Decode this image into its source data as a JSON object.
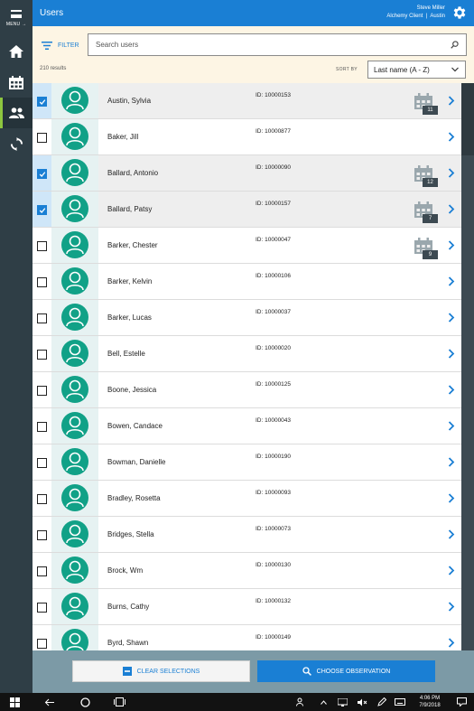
{
  "rail": {
    "menu_label": "MENU",
    "items": [
      "home-icon",
      "calendar-icon",
      "users-icon",
      "sync-icon"
    ],
    "active": "users-icon"
  },
  "header": {
    "title": "Users",
    "user_name": "Steve Miller",
    "org": "Alchemy Client",
    "location": "Austin"
  },
  "filter": {
    "filter_label": "FILTER",
    "search_placeholder": "Search users",
    "results": "210 results",
    "sort_label": "SORT BY",
    "sort_value": "Last name (A - Z)"
  },
  "users": [
    {
      "name": "Austin, Sylvia",
      "id": "ID: 10000153",
      "selected": true,
      "count": "11"
    },
    {
      "name": "Baker, Jill",
      "id": "ID: 10000877",
      "selected": false,
      "count": null
    },
    {
      "name": "Ballard, Antonio",
      "id": "ID: 10000090",
      "selected": true,
      "count": "12"
    },
    {
      "name": "Ballard, Patsy",
      "id": "ID: 10000157",
      "selected": true,
      "count": "7"
    },
    {
      "name": "Barker, Chester",
      "id": "ID: 10000047",
      "selected": false,
      "count": "9"
    },
    {
      "name": "Barker, Kelvin",
      "id": "ID: 10000106",
      "selected": false,
      "count": null
    },
    {
      "name": "Barker, Lucas",
      "id": "ID: 10000037",
      "selected": false,
      "count": null
    },
    {
      "name": "Bell, Estelle",
      "id": "ID: 10000020",
      "selected": false,
      "count": null
    },
    {
      "name": "Boone, Jessica",
      "id": "ID: 10000125",
      "selected": false,
      "count": null
    },
    {
      "name": "Bowen, Candace",
      "id": "ID: 10000043",
      "selected": false,
      "count": null
    },
    {
      "name": "Bowman, Danielle",
      "id": "ID: 10000190",
      "selected": false,
      "count": null
    },
    {
      "name": "Bradley, Rosetta",
      "id": "ID: 10000093",
      "selected": false,
      "count": null
    },
    {
      "name": "Bridges, Stella",
      "id": "ID: 10000073",
      "selected": false,
      "count": null
    },
    {
      "name": "Brock, Wm",
      "id": "ID: 10000130",
      "selected": false,
      "count": null
    },
    {
      "name": "Burns, Cathy",
      "id": "ID: 10000132",
      "selected": false,
      "count": null
    },
    {
      "name": "Byrd, Shawn",
      "id": "ID: 10000149",
      "selected": false,
      "count": null
    }
  ],
  "actions": {
    "clear_label": "CLEAR SELECTIONS",
    "choose_label": "CHOOSE OBSERVATION"
  },
  "taskbar": {
    "time": "4:06 PM",
    "date": "7/9/2018"
  },
  "colors": {
    "accent": "#1a7fd4",
    "rail": "#2f3e46",
    "avatar": "#11a187",
    "filter_bg": "#fdf5e4",
    "active_indicator": "#8dc63f"
  }
}
